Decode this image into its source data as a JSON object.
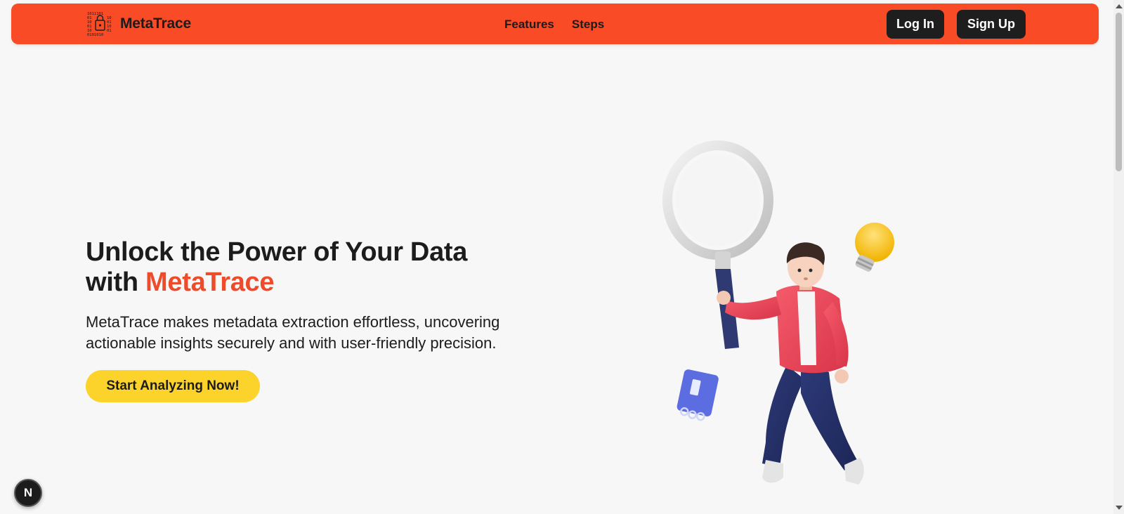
{
  "brand": {
    "name": "MetaTrace",
    "logo_icon": "binary-lock-icon"
  },
  "nav": {
    "links": [
      "Features",
      "Steps"
    ],
    "login_label": "Log In",
    "signup_label": "Sign Up"
  },
  "hero": {
    "title_line1": "Unlock the Power of Your Data",
    "title_prefix": "with ",
    "title_accent": "MetaTrace",
    "description": "MetaTrace makes metadata extraction effortless, uncovering actionable insights securely and with user-friendly precision.",
    "cta_label": "Start Analyzing Now!"
  },
  "illustration": {
    "subject": "person-with-magnifying-glass-illustration",
    "extras": [
      "lightbulb-icon",
      "notebook-icon"
    ]
  },
  "dev_badge": {
    "letter": "N"
  },
  "colors": {
    "navbar": "#f84b26",
    "accent": "#ee4b2b",
    "cta": "#fcd32a",
    "dark_button": "#1e1e1e",
    "background": "#f7f7f7"
  }
}
